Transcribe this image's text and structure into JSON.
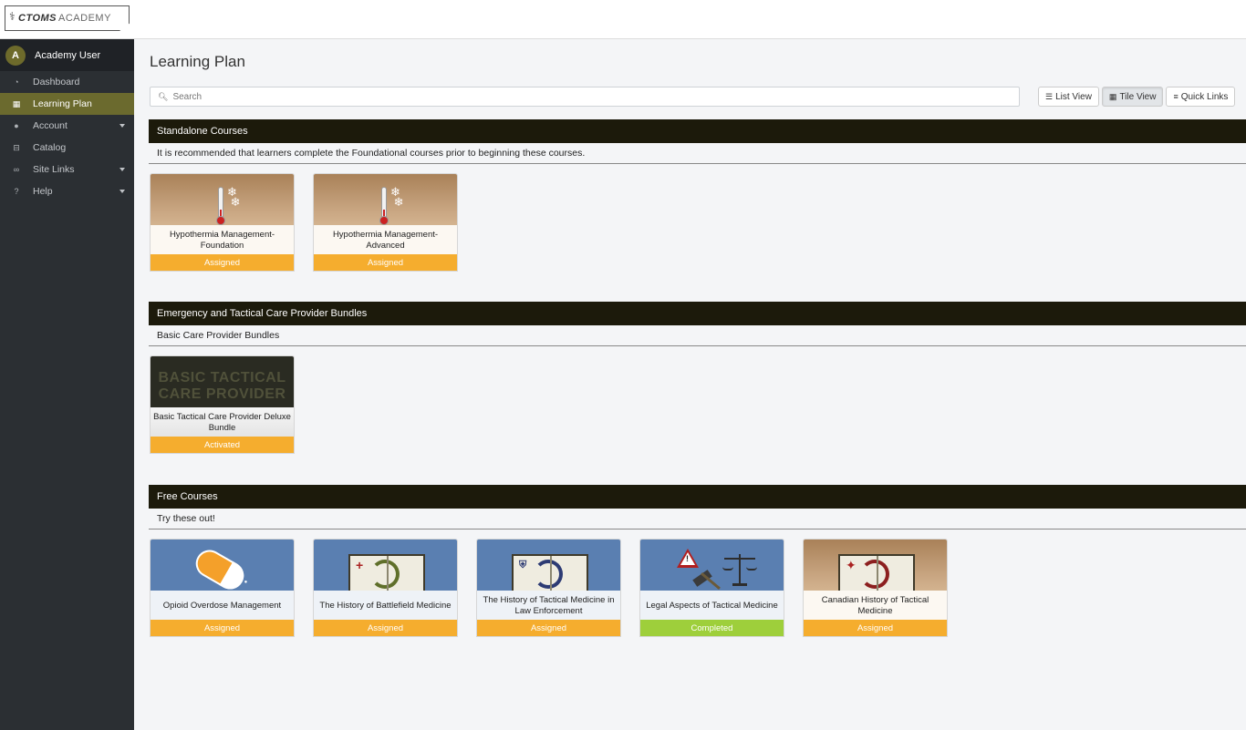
{
  "brand": {
    "name_bold": "CTOMS",
    "name_light": "ACADEMY"
  },
  "user": {
    "initial": "A",
    "name": "Academy User"
  },
  "sidebar": {
    "items": [
      {
        "label": "Dashboard",
        "icon": "dashboard-icon",
        "active": false,
        "has_caret": false
      },
      {
        "label": "Learning Plan",
        "icon": "grid-icon",
        "active": true,
        "has_caret": false
      },
      {
        "label": "Account",
        "icon": "user-icon",
        "active": false,
        "has_caret": true
      },
      {
        "label": "Catalog",
        "icon": "basket-icon",
        "active": false,
        "has_caret": false
      },
      {
        "label": "Site Links",
        "icon": "link-icon",
        "active": false,
        "has_caret": true
      },
      {
        "label": "Help",
        "icon": "question-icon",
        "active": false,
        "has_caret": true
      }
    ]
  },
  "page": {
    "title": "Learning Plan"
  },
  "search": {
    "placeholder": "Search",
    "value": ""
  },
  "views": {
    "list": "List View",
    "tile": "Tile View",
    "quick": "Quick Links",
    "active": "tile"
  },
  "sections": [
    {
      "title": "Standalone Courses",
      "description": "It is recommended that learners complete the Foundational courses prior to beginning these courses.",
      "tiles": [
        {
          "name": "Hypothermia Management-Foundation",
          "status": "Assigned"
        },
        {
          "name": "Hypothermia Management-Advanced",
          "status": "Assigned"
        }
      ]
    },
    {
      "title": "Emergency and Tactical Care Provider Bundles",
      "description": "Basic Care Provider Bundles",
      "tiles": [
        {
          "name": "Basic Tactical Care Provider Deluxe Bundle",
          "status": "Activated",
          "image_text": "BASIC TACTICAL CARE PROVIDER"
        }
      ]
    },
    {
      "title": "Free Courses",
      "description": "Try these out!",
      "tiles": [
        {
          "name": "Opioid Overdose Management",
          "status": "Assigned"
        },
        {
          "name": "The History of Battlefield Medicine",
          "status": "Assigned"
        },
        {
          "name": "The History of Tactical Medicine in Law Enforcement",
          "status": "Assigned"
        },
        {
          "name": "Legal Aspects of Tactical Medicine",
          "status": "Completed"
        },
        {
          "name": "Canadian History of Tactical Medicine",
          "status": "Assigned"
        }
      ]
    }
  ],
  "colors": {
    "section_header": "#1c1a0b",
    "active_nav": "#6b6a2e",
    "assigned": "#f5ad2e",
    "completed": "#9ecf3b"
  }
}
